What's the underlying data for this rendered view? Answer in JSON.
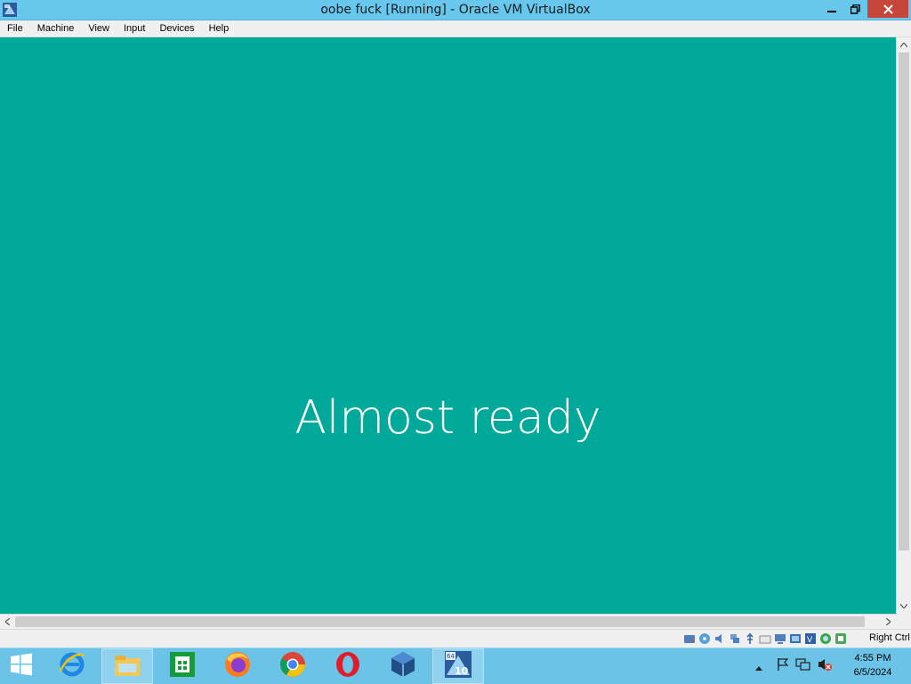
{
  "window": {
    "title": "oobe fuck [Running] - Oracle VM VirtualBox",
    "icon": "virtualbox-icon",
    "controls": [
      "minimize-icon",
      "restore-icon",
      "close-icon"
    ]
  },
  "menu": {
    "items": [
      "File",
      "Machine",
      "View",
      "Input",
      "Devices",
      "Help"
    ]
  },
  "vm_screen": {
    "message": "Almost ready",
    "background": "#00a99a"
  },
  "statusbar": {
    "icons": [
      "hard-disk-icon",
      "optical-drive-icon",
      "audio-icon",
      "network-icon",
      "usb-icon",
      "shared-folders-icon",
      "display-icon",
      "video-capture-icon",
      "virtualization-icon",
      "mouse-integration-icon",
      "keyboard-icon"
    ],
    "host_key": "Right Ctrl"
  },
  "taskbar": {
    "items": [
      "start-icon",
      "internet-explorer-icon",
      "file-explorer-icon",
      "store-icon",
      "firefox-icon",
      "chrome-icon",
      "opera-icon",
      "virtualbox-icon",
      "windows10-vm-icon"
    ],
    "tray_icons": [
      "show-hidden-icons-icon",
      "action-center-flag-icon",
      "network-icon",
      "volume-muted-icon"
    ],
    "time": "4:55 PM",
    "date": "6/5/2024"
  },
  "colors": {
    "titlebar": "#67c7ec",
    "close": "#c7463b",
    "taskbar": "#6cc3e8"
  }
}
